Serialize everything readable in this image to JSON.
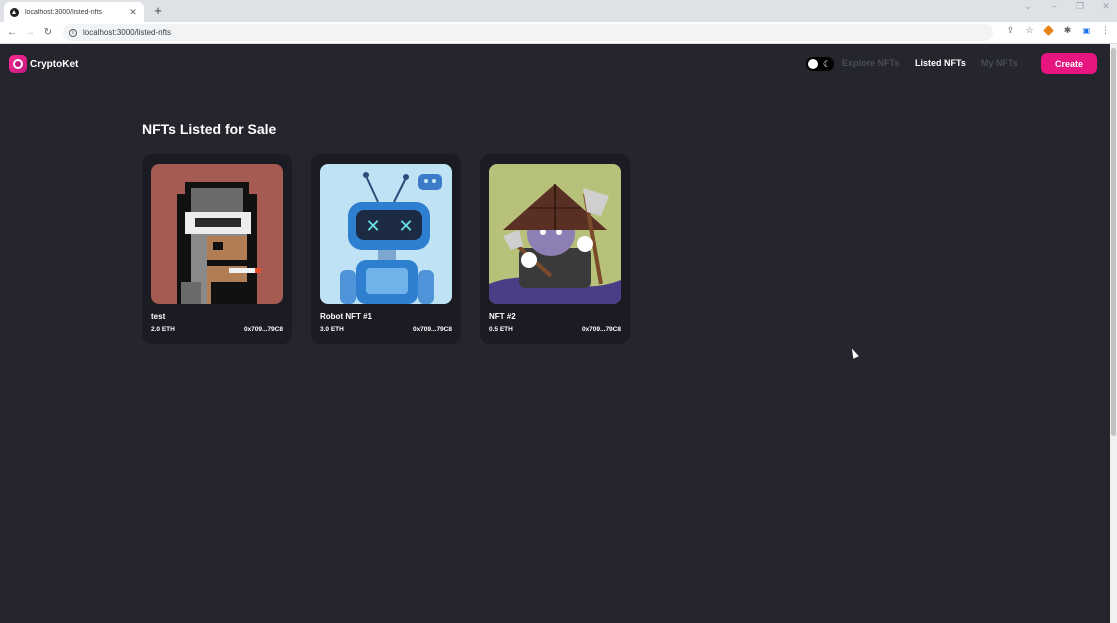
{
  "browser": {
    "tab_title": "localhost:3000/listed-nfts",
    "url": "localhost:3000/listed-nfts"
  },
  "app": {
    "logo_text": "CryptoKet",
    "nav": {
      "explore": "Explore NFTs",
      "listed": "Listed NFTs",
      "my": "My NFTs",
      "active": "Listed NFTs"
    },
    "create_label": "Create",
    "page_title": "NFTs Listed for Sale",
    "colors": {
      "background": "#24252d",
      "card": "#1b1b23",
      "accent": "#e6157f",
      "nav_inactive": "#4b4c59"
    }
  },
  "nfts": [
    {
      "name": "test",
      "price": "2.0 ETH",
      "owner": "0x709...79C8",
      "image": "pixel-hooded-figure-icon"
    },
    {
      "name": "Robot NFT #1",
      "price": "3.0 ETH",
      "owner": "0x709...79C8",
      "image": "robot-icon"
    },
    {
      "name": "NFT #2",
      "price": "0.5 ETH",
      "owner": "0x709...79C8",
      "image": "samurai-rabbit-icon"
    }
  ]
}
